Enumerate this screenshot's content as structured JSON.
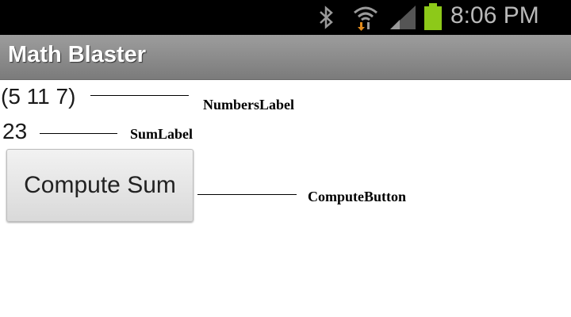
{
  "status_bar": {
    "time": "8:06 PM",
    "icons": [
      "bluetooth-icon",
      "wifi-icon",
      "signal-icon",
      "battery-icon"
    ],
    "battery_color": "#8dc919"
  },
  "app": {
    "title": "Math Blaster"
  },
  "main": {
    "numbers_label": "(5 11 7)",
    "sum_label": "23",
    "compute_button": "Compute Sum"
  },
  "annotations": {
    "numbers": "NumbersLabel",
    "sum": "SumLabel",
    "button": "ComputeButton"
  }
}
